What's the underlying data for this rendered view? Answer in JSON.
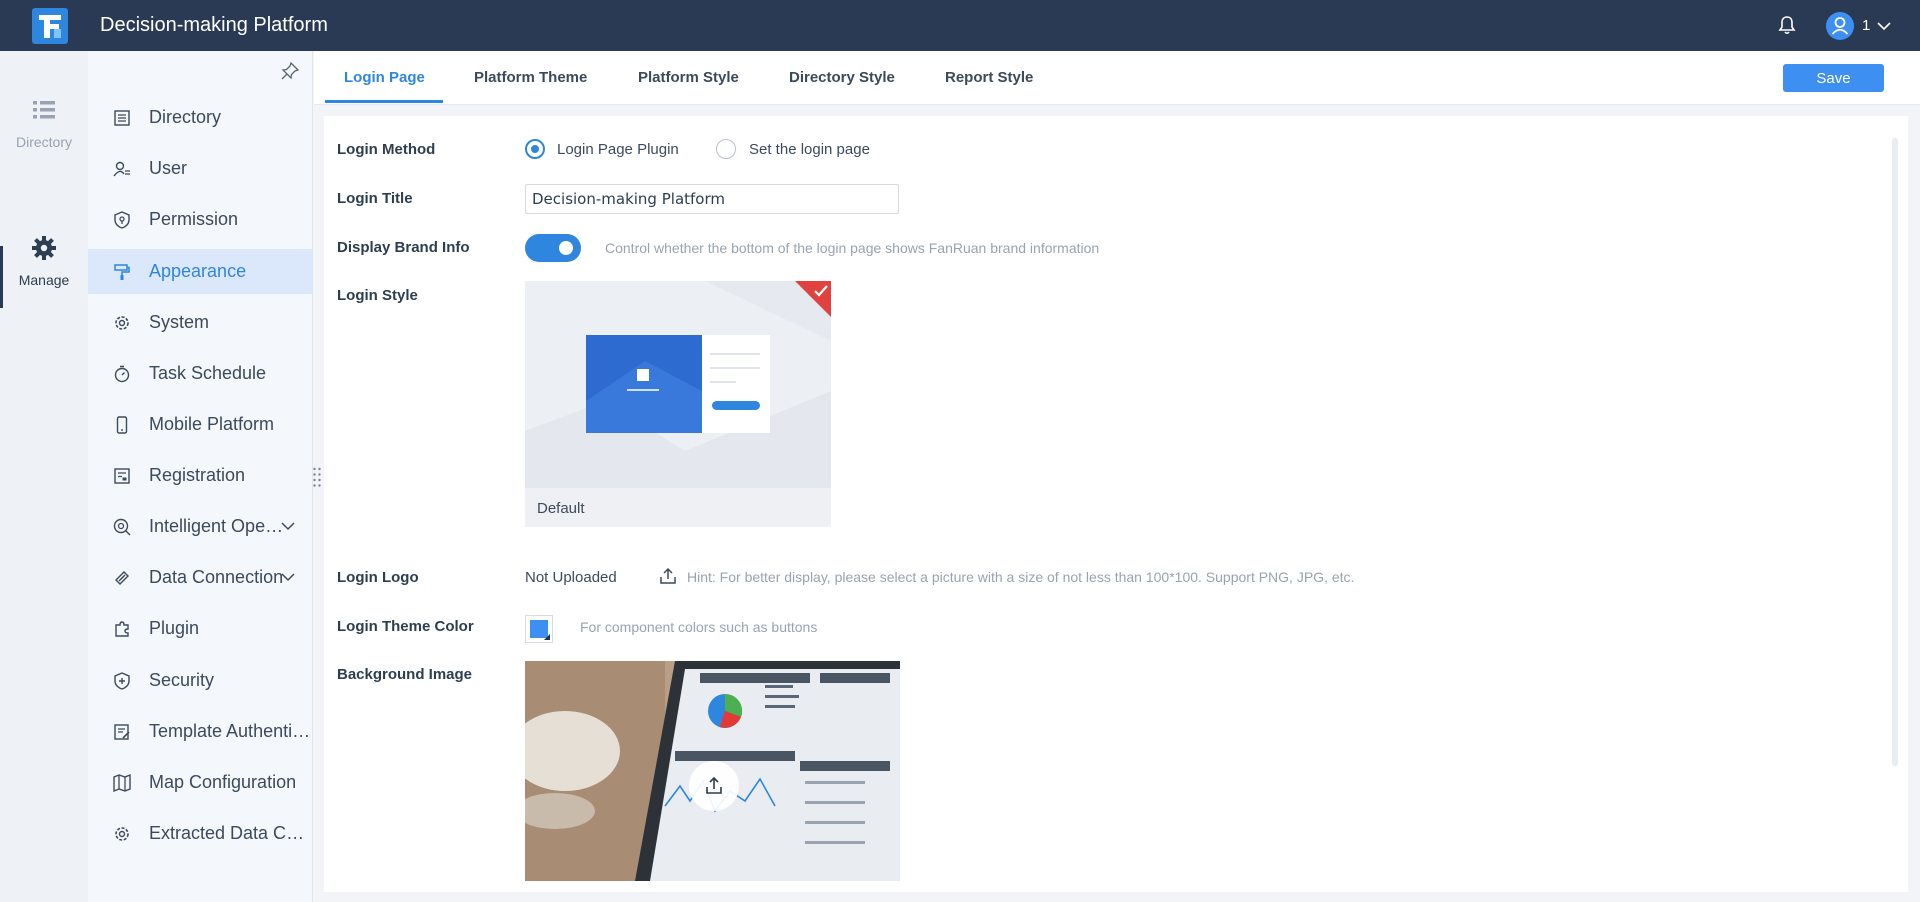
{
  "header": {
    "app_title": "Decision-making Platform",
    "user_name": "1"
  },
  "rail": {
    "items": [
      {
        "label": "Directory",
        "icon": "list-icon",
        "active": false
      },
      {
        "label": "Manage",
        "icon": "gear-icon",
        "active": true
      }
    ]
  },
  "sidebar": {
    "items": [
      {
        "label": "Directory",
        "icon": "directory-icon"
      },
      {
        "label": "User",
        "icon": "user-icon"
      },
      {
        "label": "Permission",
        "icon": "permission-icon"
      },
      {
        "label": "Appearance",
        "icon": "paint-roller-icon",
        "active": true
      },
      {
        "label": "System",
        "icon": "gear-icon"
      },
      {
        "label": "Task Schedule",
        "icon": "stopwatch-icon"
      },
      {
        "label": "Mobile Platform",
        "icon": "mobile-icon"
      },
      {
        "label": "Registration",
        "icon": "registration-icon"
      },
      {
        "label": "Intelligent Ope…",
        "icon": "intelligent-ops-icon",
        "expandable": true
      },
      {
        "label": "Data Connection",
        "icon": "link-icon",
        "expandable": true
      },
      {
        "label": "Plugin",
        "icon": "puzzle-icon"
      },
      {
        "label": "Security",
        "icon": "shield-icon"
      },
      {
        "label": "Template Authentic…",
        "icon": "template-auth-icon"
      },
      {
        "label": "Map Configuration",
        "icon": "map-icon"
      },
      {
        "label": "Extracted Data Ca…",
        "icon": "gear-icon"
      }
    ]
  },
  "tabs": [
    {
      "label": "Login Page",
      "active": true
    },
    {
      "label": "Platform Theme"
    },
    {
      "label": "Platform Style"
    },
    {
      "label": "Directory Style"
    },
    {
      "label": "Report Style"
    }
  ],
  "toolbar": {
    "save_label": "Save"
  },
  "form": {
    "login_method": {
      "label": "Login Method",
      "options": [
        {
          "label": "Login Page Plugin",
          "selected": true
        },
        {
          "label": "Set the login page",
          "selected": false
        }
      ]
    },
    "login_title": {
      "label": "Login Title",
      "value": "Decision-making Platform"
    },
    "display_brand": {
      "label": "Display Brand Info",
      "enabled": true,
      "hint": "Control whether the bottom of the login page shows FanRuan brand information"
    },
    "login_style": {
      "label": "Login Style",
      "card_label": "Default",
      "selected": true
    },
    "login_logo": {
      "label": "Login Logo",
      "status": "Not Uploaded",
      "hint": "Hint: For better display, please select a picture with a size of not less than 100*100. Support PNG, JPG, etc."
    },
    "theme_color": {
      "label": "Login Theme Color",
      "color": "#3d8ff2",
      "hint": "For component colors such as buttons"
    },
    "background_image": {
      "label": "Background Image"
    }
  },
  "colors": {
    "topbar": "#2a3a55",
    "accent": "#2e86de",
    "selected_corner": "#e0423f"
  }
}
